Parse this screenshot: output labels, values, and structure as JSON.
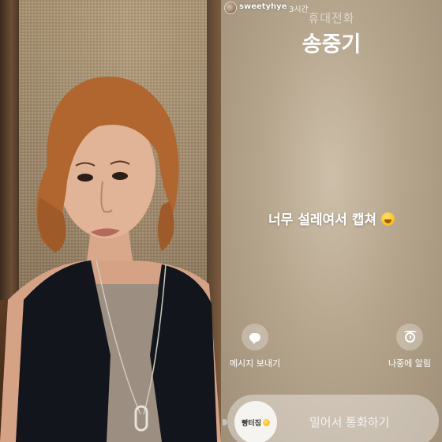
{
  "story": {
    "username": "sweetyhye",
    "time": "3시간"
  },
  "call": {
    "type": "휴대전화",
    "caller": "송중기",
    "caption": "너무 설레여서 캡쳐",
    "caption_emoji": "fearful-face-emoji",
    "actions": [
      {
        "label": "메시지 보내기",
        "icon": "message-bubble-icon"
      },
      {
        "label": "나중에 알림",
        "icon": "alarm-clock-icon"
      }
    ],
    "swipe": {
      "knob_text": "빵터짐",
      "knob_emoji": "laughing-face-emoji",
      "label": "밀어서 통화하기"
    }
  }
}
